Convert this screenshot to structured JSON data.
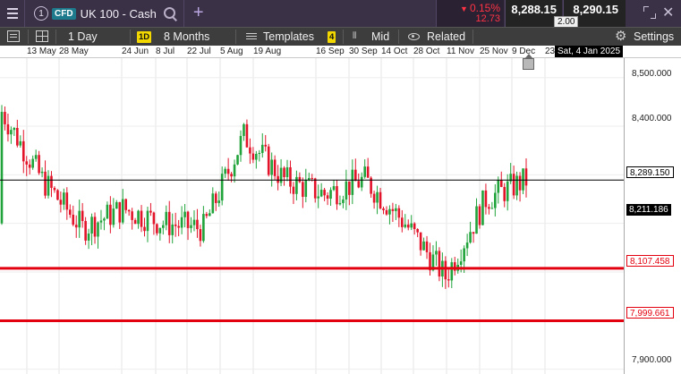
{
  "topbar": {
    "instrument_number": "1",
    "cfd_badge": "CFD",
    "instrument_name": "UK 100 - Cash",
    "change_pct": "0.15%",
    "change_pts": "12.73",
    "bid": "8,288.15",
    "ask": "8,290.15",
    "spread": "2.00",
    "colors": {
      "bar_bg": "#3a3146",
      "negative": "#ff3344"
    }
  },
  "toolbar": {
    "interval": "1 Day",
    "interval_badge": "1D",
    "range": "8 Months",
    "templates": "Templates",
    "templates_count": "4",
    "price_type": "Mid",
    "related": "Related",
    "settings": "Settings",
    "icons": [
      "list-icon",
      "grid-icon",
      "templates-icon",
      "mid-icon",
      "eye-icon",
      "gear-icon"
    ]
  },
  "date_axis": {
    "labels": [
      "13 May",
      "28 May",
      "24 Jun",
      "8 Jul",
      "22 Jul",
      "5 Aug",
      "19 Aug",
      "16 Sep",
      "30 Sep",
      "14 Oct",
      "28 Oct",
      "11 Nov",
      "25 Nov",
      "9 Dec",
      "23"
    ],
    "cursor_date": "Sat, 4 Jan 2025"
  },
  "price_axis": {
    "ticks": [
      "8,500.000",
      "8,400.000",
      "7,900.000"
    ],
    "current_price": "8,289.150",
    "crosshair_price": "8,211.186",
    "level_1": "8,107.458",
    "level_2": "7,999.661"
  },
  "chart_data": {
    "type": "candlestick",
    "instrument": "UK 100 - Cash",
    "interval": "1 Day",
    "ylim": [
      7890,
      8540
    ],
    "x": [
      "13 May",
      "28 May",
      "24 Jun",
      "8 Jul",
      "22 Jul",
      "5 Aug",
      "19 Aug",
      "16 Sep",
      "30 Sep",
      "14 Oct",
      "28 Oct",
      "11 Nov",
      "25 Nov",
      "9 Dec"
    ],
    "close": [
      8430,
      8290,
      8190,
      8230,
      8200,
      8190,
      8380,
      8290,
      8260,
      8290,
      8200,
      8090,
      8250,
      8289
    ],
    "horizontal_lines": [
      {
        "value": 8289.15,
        "color": "#000000",
        "style": "thin"
      },
      {
        "value": 8107.458,
        "color": "#e3000f",
        "style": "thick"
      },
      {
        "value": 7999.661,
        "color": "#e3000f",
        "style": "thick"
      }
    ],
    "grid": true,
    "colors": {
      "up": "#1fa33a",
      "down": "#e3142a"
    }
  }
}
